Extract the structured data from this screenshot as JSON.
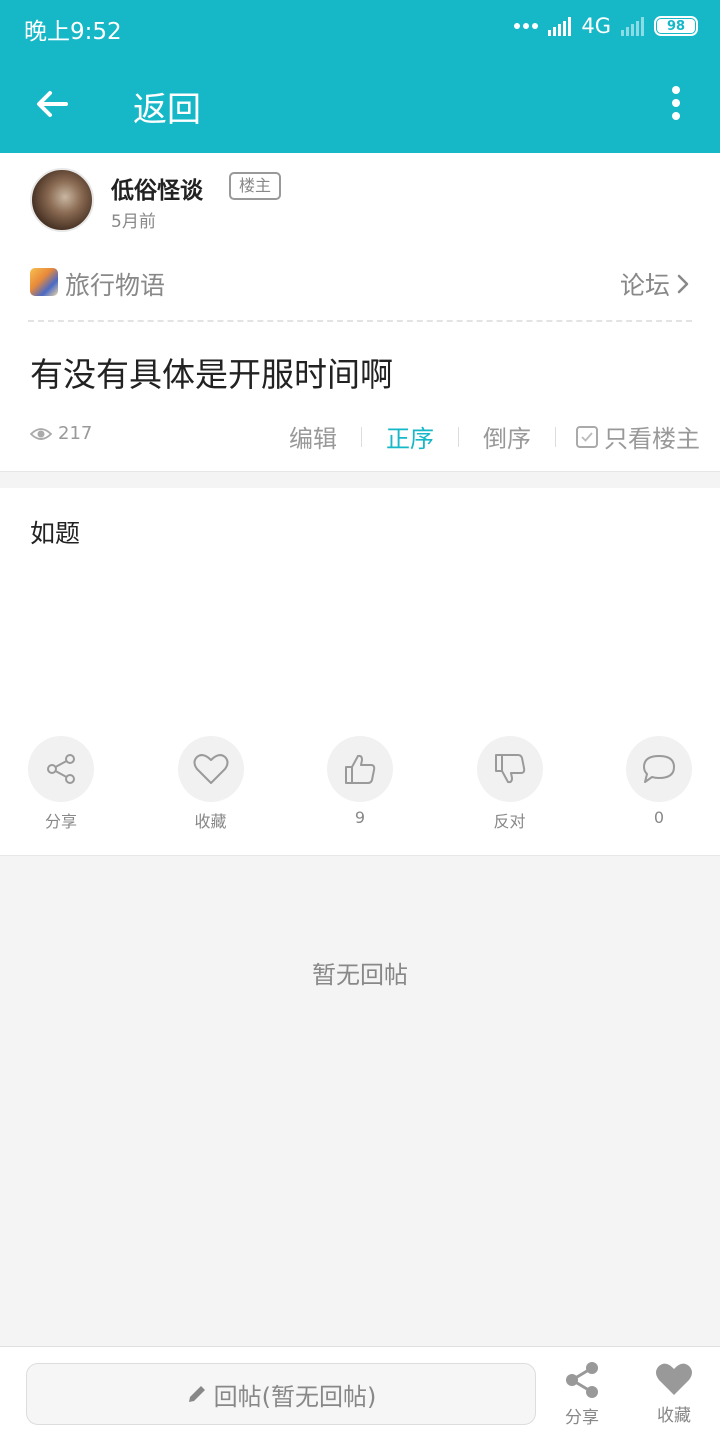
{
  "status_bar": {
    "time": "晚上9:52",
    "network": "4G",
    "battery": "98"
  },
  "app_bar": {
    "title": "返回"
  },
  "post": {
    "author": "低俗怪谈",
    "owner_badge": "楼主",
    "time": "5月前",
    "forum": "旅行物语",
    "forum_link": "论坛",
    "title": "有没有具体是开服时间啊",
    "views": "217",
    "sort": {
      "edit": "编辑",
      "asc": "正序",
      "desc": "倒序",
      "only_owner": "只看楼主"
    },
    "content": "如题"
  },
  "actions": [
    {
      "label": "分享",
      "icon": "share-icon"
    },
    {
      "label": "收藏",
      "icon": "heart-icon"
    },
    {
      "label": "9",
      "icon": "thumbs-up-icon"
    },
    {
      "label": "反对",
      "icon": "thumbs-down-icon"
    },
    {
      "label": "0",
      "icon": "comment-icon"
    }
  ],
  "replies": {
    "empty_text": "暂无回帖"
  },
  "bottom_bar": {
    "reply_placeholder": "回帖(暂无回帖)",
    "share": "分享",
    "favorite": "收藏"
  },
  "colors": {
    "accent": "#16b8c8"
  }
}
